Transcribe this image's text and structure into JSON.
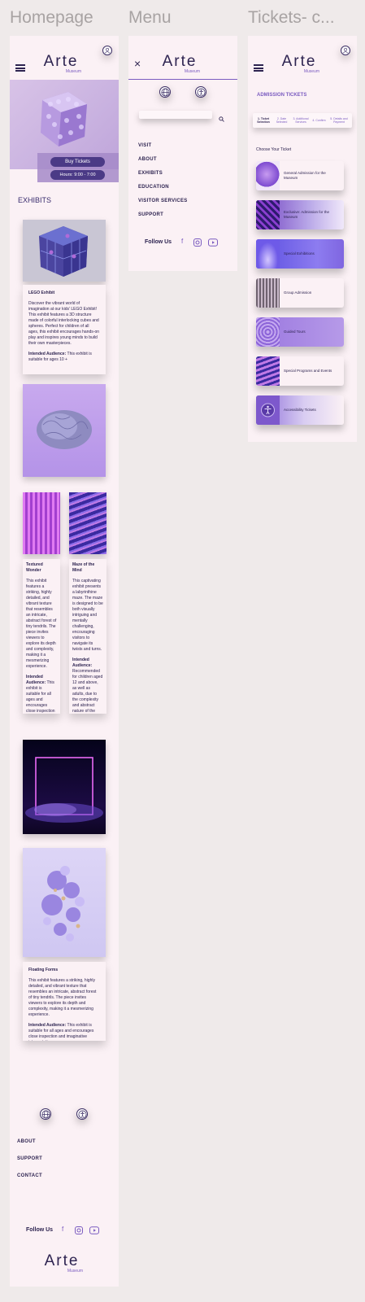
{
  "frames": {
    "homepage_title": "Homepage",
    "menu_title": "Menu",
    "tickets_title": "Tickets- c..."
  },
  "brand": {
    "name": "Arte",
    "sub": "Museum"
  },
  "homepage": {
    "buy_tickets": "Buy Tickets",
    "hours": "Hours: 9:00 - 7:00",
    "exhibits_heading": "EXHIBITS",
    "lego": {
      "title": "LEGO Exhibit",
      "body": "Discover the vibrant world of imagination at our kids' LEGO Exhibit! This exhibit features a 3D structure made of colorful interlocking cubes and spheres. Perfect for children of all ages, this exhibit encourages hands-on play and inspires young minds to build their own masterpieces.",
      "audience_label": "Intended Audience:",
      "audience": "This exhibit is suitable for ages 10 +"
    },
    "textured": {
      "title": "Textured Wonder",
      "body": "This exhibit features a striking, highly detailed, and vibrant texture that resembles an intricate, abstract forest of tiny tendrils. The piece invites viewers to explore its depth and complexity, making it a mesmerizing experience.",
      "audience_label": "Intended Audience:",
      "audience": "This exhibit is suitable for all ages and encourages close inspection and imaginative interpretation."
    },
    "maze": {
      "title": "Maze of the Mind",
      "body": "This captivating exhibit presents a labyrinthine maze. The maze is designed to be both visually intriguing and mentally challenging, encouraging visitors to navigate its twists and turns.",
      "audience_label": "Intended Audience:",
      "audience": "Recommended for children aged 12 and above, as well as adults, due to the complexity and abstract nature of the maze."
    },
    "floating": {
      "title": "Floating Forms",
      "body": "This exhibit features a striking, highly detailed, and vibrant texture that resembles an intricate, abstract forest of tiny tendrils. The piece invites viewers to explore its depth and complexity, making it a mesmerizing experience.",
      "audience_label": "Intended Audience:",
      "audience": "This exhibit is suitable for all ages and encourages close inspection and imaginative interpretation."
    },
    "footer_links": [
      "ABOUT",
      "SUPPORT",
      "CONTACT"
    ],
    "follow_us": "Follow Us"
  },
  "menu": {
    "close": "×",
    "links": [
      "VISIT",
      "ABOUT",
      "EXHIBITS",
      "EDUCATION",
      "VISITOR SERVICES",
      "SUPPORT"
    ],
    "follow_us": "Follow Us"
  },
  "tickets": {
    "heading": "ADMISSION TICKETS",
    "steps": [
      "1. Ticket Selection",
      "2. Date Selected",
      "3. Additional Services",
      "4. Confirm",
      "5. Details and Payment"
    ],
    "choose": "Choose Your Ticket",
    "options": [
      "General Admission for the Museum",
      "Exclusive: Admission for the Museum",
      "Special Exhibitions",
      "Group Admission",
      "Guided Tours",
      "Special Programs and Events",
      "Accessibility Tickets"
    ]
  },
  "icons": {
    "menu": "hamburger-icon",
    "user": "user-icon",
    "close": "close-icon",
    "globe": "globe-icon",
    "accessibility": "accessibility-icon",
    "search": "search-icon",
    "facebook": "facebook-icon",
    "instagram": "instagram-icon",
    "youtube": "youtube-icon"
  },
  "colors": {
    "accent": "#7b5cc0",
    "dark": "#2d2350",
    "frame_bg": "#fbf1f5",
    "canvas_bg": "#efeaea"
  }
}
